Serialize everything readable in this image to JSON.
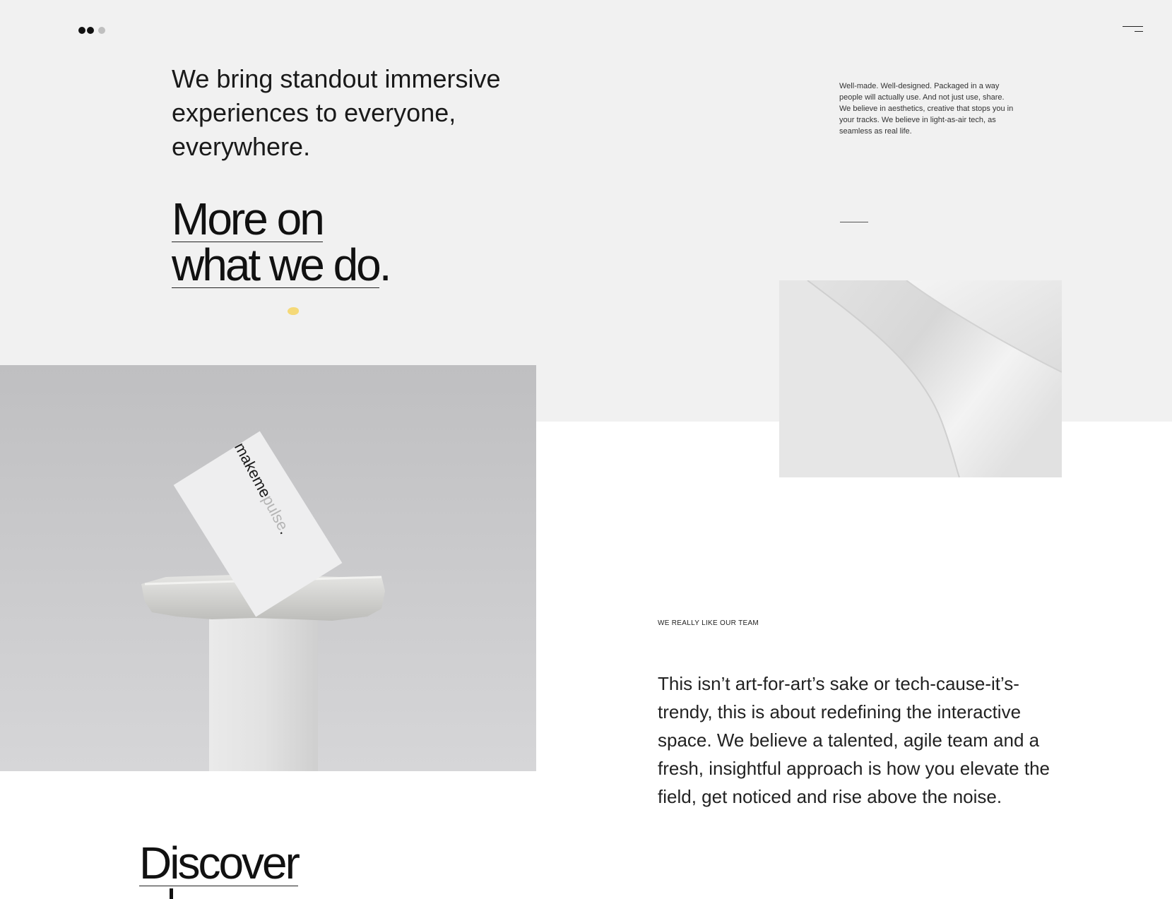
{
  "header": {
    "logo_icon": "three-dots-logo",
    "menu_icon": "hamburger-menu-icon"
  },
  "hero": {
    "intro": "We bring standout immersive experiences to everyone, everywhere.",
    "more_link": {
      "line1": "More on",
      "line2": "what we do",
      "period": "."
    }
  },
  "aside": {
    "copy": "Well-made. Well-designed. Packaged in a way people will actually use. And not just use, share. We believe in aesthetics, creative that stops you in your tracks. We believe in light-as-air tech, as seamless as real life."
  },
  "card": {
    "brand_dark": "makeme",
    "brand_light": "pulse",
    "brand_period": "."
  },
  "team": {
    "label": "WE REALLY LIKE OUR TEAM",
    "copy": "This isn’t art-for-art’s sake or tech-cause-it’s-trendy, this is about redefining the interactive space. We believe a talented, agile team and a fresh, insightful approach is how you elevate the field, get noticed and rise above the noise."
  },
  "discover": {
    "line1": "Discover"
  },
  "colors": {
    "top_band": "#f1f1f1",
    "accent_blob": "#f5d978",
    "text": "#111111"
  }
}
